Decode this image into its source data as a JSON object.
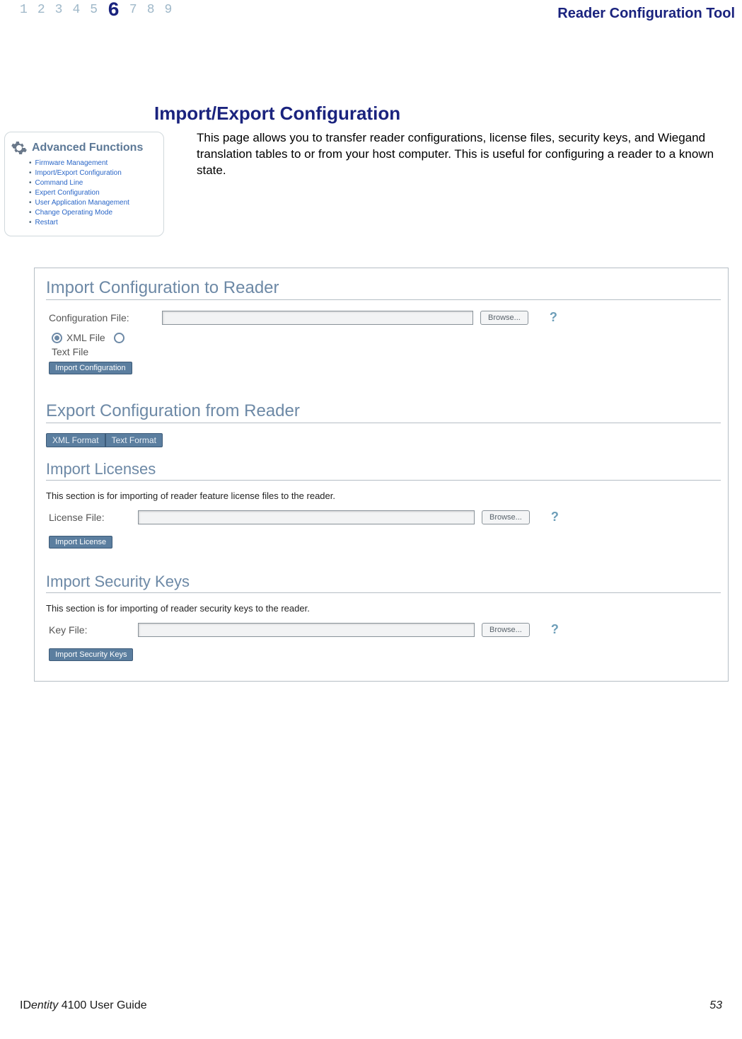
{
  "header": {
    "nums": [
      "1",
      "2",
      "3",
      "4",
      "5",
      "6",
      "7",
      "8",
      "9"
    ],
    "activeIndex": 5,
    "title": "Reader Configuration Tool"
  },
  "section": {
    "title": "Import/Export Configuration",
    "intro": "This page allows you to transfer reader configurations, license files, security keys, and Wiegand translation tables to or from your host computer. This is useful for configuring a reader to a known state."
  },
  "sidebar": {
    "title": "Advanced Functions",
    "items": [
      "Firmware Management",
      "Import/Export Configuration",
      "Command Line",
      "Expert Configuration",
      "User Application Management",
      "Change Operating Mode",
      "Restart"
    ]
  },
  "panel": {
    "importConfig": {
      "heading": "Import Configuration to Reader",
      "fileLabel": "Configuration File:",
      "browse": "Browse...",
      "radioXml": "XML File",
      "radioText": "Text File",
      "button": "Import Configuration"
    },
    "exportConfig": {
      "heading": "Export Configuration from Reader",
      "xmlBtn": "XML Format",
      "textBtn": "Text Format"
    },
    "importLicenses": {
      "heading": "Import Licenses",
      "desc": "This section is for importing of reader feature license files to the reader.",
      "fileLabel": "License File:",
      "browse": "Browse...",
      "button": "Import License"
    },
    "importKeys": {
      "heading": "Import Security Keys",
      "desc": "This section is for importing of reader security keys to the reader.",
      "fileLabel": "Key File:",
      "browse": "Browse...",
      "button": "Import Security Keys"
    },
    "help": "?"
  },
  "footer": {
    "guidePrefix": "ID",
    "guideItalic": "entity",
    "guideRest": " 4100 User Guide",
    "page": "53"
  }
}
